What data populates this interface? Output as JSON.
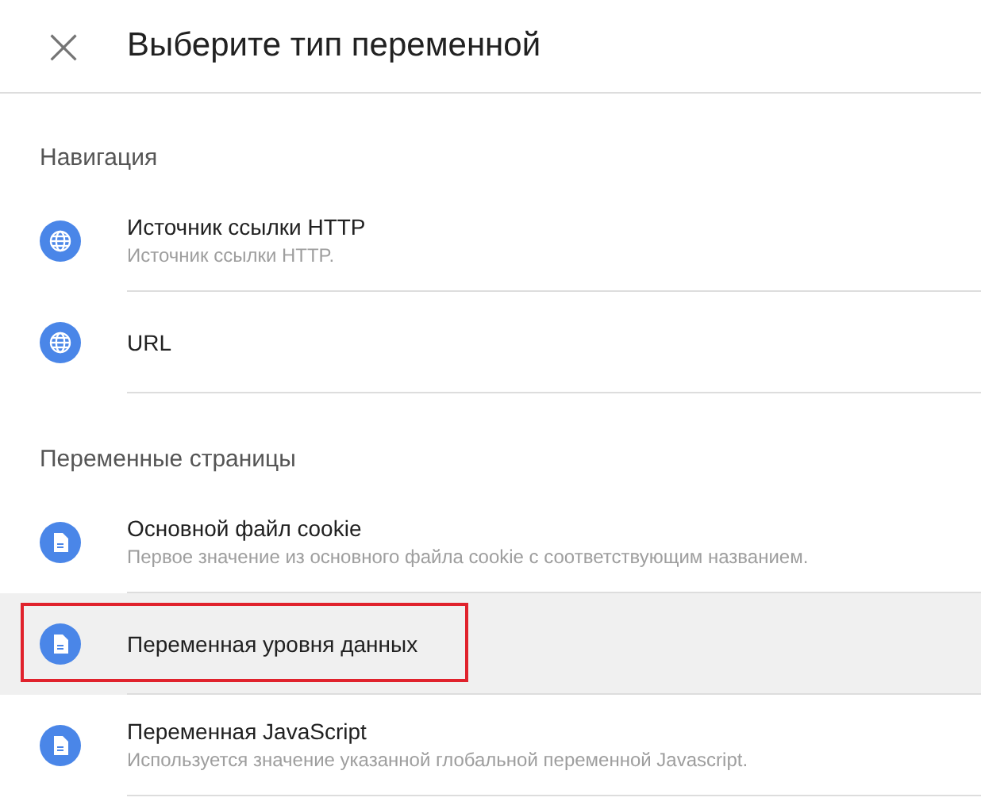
{
  "dialog": {
    "title": "Выберите тип переменной",
    "close": "×"
  },
  "sections": [
    {
      "heading": "Навигация",
      "items": [
        {
          "kind": "globe",
          "title": "Источник ссылки HTTP",
          "description": "Источник ссылки HTTP.",
          "selected": false,
          "outlined": false
        },
        {
          "kind": "globe",
          "title": "URL",
          "selected": false,
          "outlined": false
        }
      ]
    },
    {
      "heading": "Переменные страницы",
      "items": [
        {
          "kind": "document",
          "title": "Основной файл cookie",
          "description": "Первое значение из основного файла cookie с соответствующим названием.",
          "selected": false,
          "outlined": false
        },
        {
          "kind": "document",
          "title": "Переменная уровня данных",
          "selected": true,
          "outlined": true
        },
        {
          "kind": "document",
          "title": "Переменная JavaScript",
          "description": "Используется значение указанной глобальной переменной Javascript.",
          "selected": false,
          "outlined": false
        }
      ]
    }
  ]
}
